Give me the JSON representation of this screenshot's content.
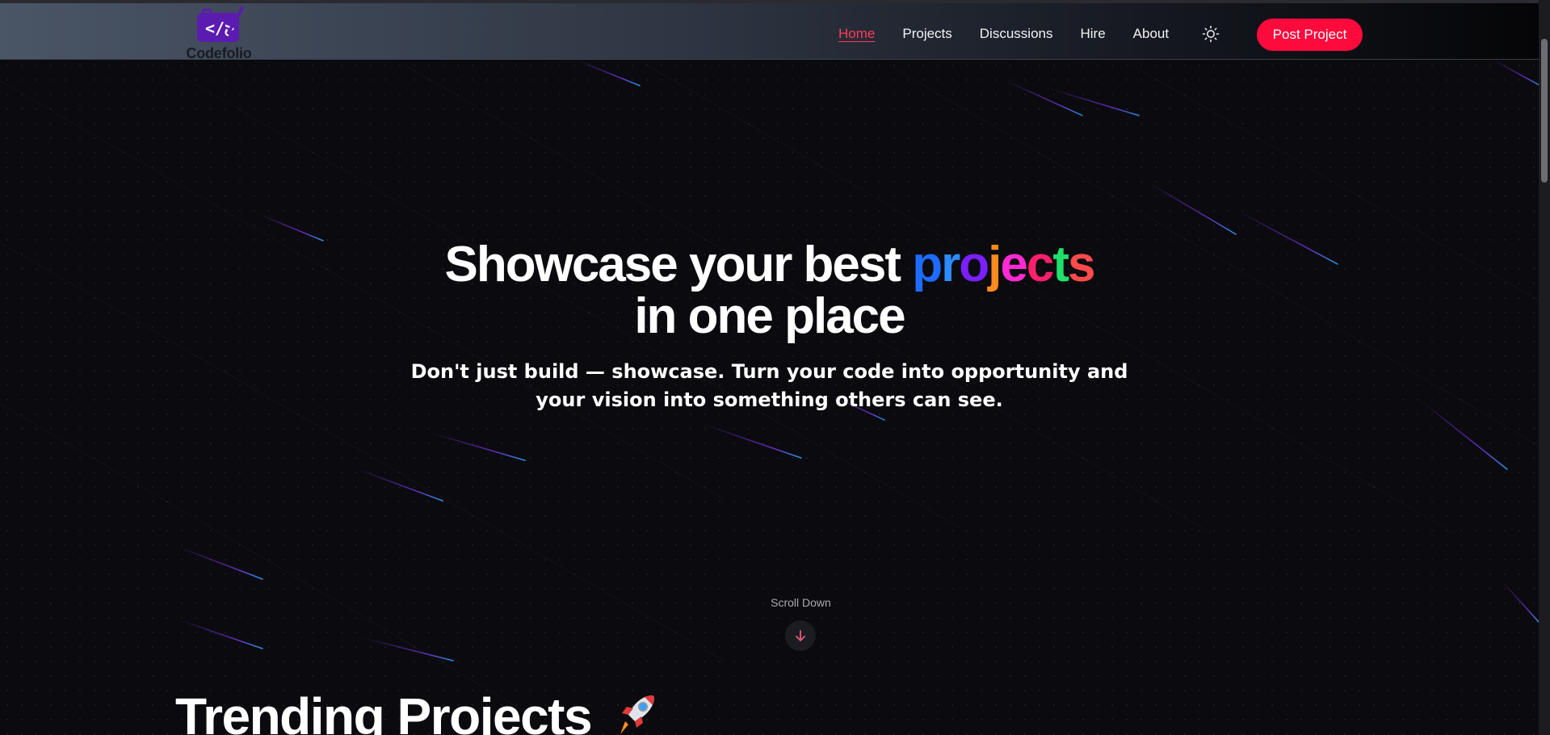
{
  "brand": {
    "name": "Codefolio",
    "logo_icon": "code-briefcase-icon"
  },
  "nav": {
    "items": [
      {
        "label": "Home",
        "active": true
      },
      {
        "label": "Projects",
        "active": false
      },
      {
        "label": "Discussions",
        "active": false
      },
      {
        "label": "Hire",
        "active": false
      },
      {
        "label": "About",
        "active": false
      }
    ],
    "theme_icon": "sun-icon",
    "cta_label": "Post Project"
  },
  "hero": {
    "title_prefix": "Showcase your best ",
    "title_highlight_letters": [
      {
        "char": "p",
        "color": "#1e6bff"
      },
      {
        "char": "r",
        "color": "#2b8bff"
      },
      {
        "char": "o",
        "color": "#7a1fff"
      },
      {
        "char": "j",
        "color": "#ff8a1f"
      },
      {
        "char": "e",
        "color": "#ff2bd2"
      },
      {
        "char": "c",
        "color": "#ff1f6b"
      },
      {
        "char": "t",
        "color": "#1fe06a"
      },
      {
        "char": "s",
        "color": "#ff4b4b"
      }
    ],
    "title_line2": "in one place",
    "subtitle_line1": "Don't just build — showcase. Turn your code into opportunity and",
    "subtitle_line2": "your vision into something others can see.",
    "scroll_label": "Scroll Down",
    "scroll_icon": "arrow-down-icon"
  },
  "section": {
    "title": "Trending Projects",
    "icon": "rocket-icon"
  },
  "colors": {
    "accent": "#ff0a3c",
    "background": "#0b0b0f",
    "logo_purple": "#5b1bb0"
  }
}
